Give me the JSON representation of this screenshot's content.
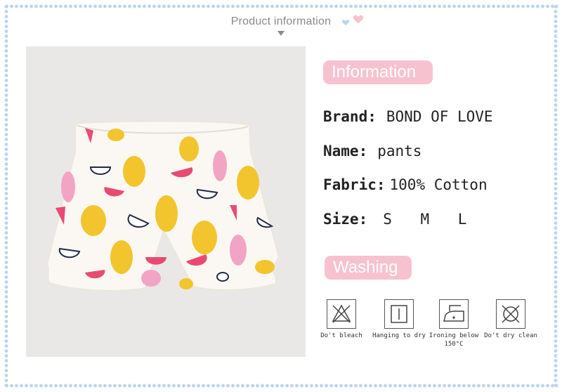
{
  "header": {
    "title": "Product information"
  },
  "sections": {
    "info_title": "Information",
    "wash_title": "Washing"
  },
  "specs": {
    "brand_label": "Brand:",
    "brand_value": "BOND OF LOVE",
    "name_label": "Name:",
    "name_value": "pants",
    "fabric_label": "Fabric:",
    "fabric_value": "100% Cotton",
    "size_label": "Size:",
    "size_value": "S  M  L"
  },
  "care": [
    {
      "icon": "no-bleach-icon",
      "label": "Do't bleach"
    },
    {
      "icon": "hang-dry-icon",
      "label": "Hanging to dry"
    },
    {
      "icon": "iron-icon",
      "label": "Ironing below 150°C"
    },
    {
      "icon": "no-dry-clean-icon",
      "label": "Do't dry clean"
    }
  ],
  "colors": {
    "accent": "#f7c2cf",
    "border": "#b8d6ee",
    "photo_bg": "#eae8e6"
  }
}
